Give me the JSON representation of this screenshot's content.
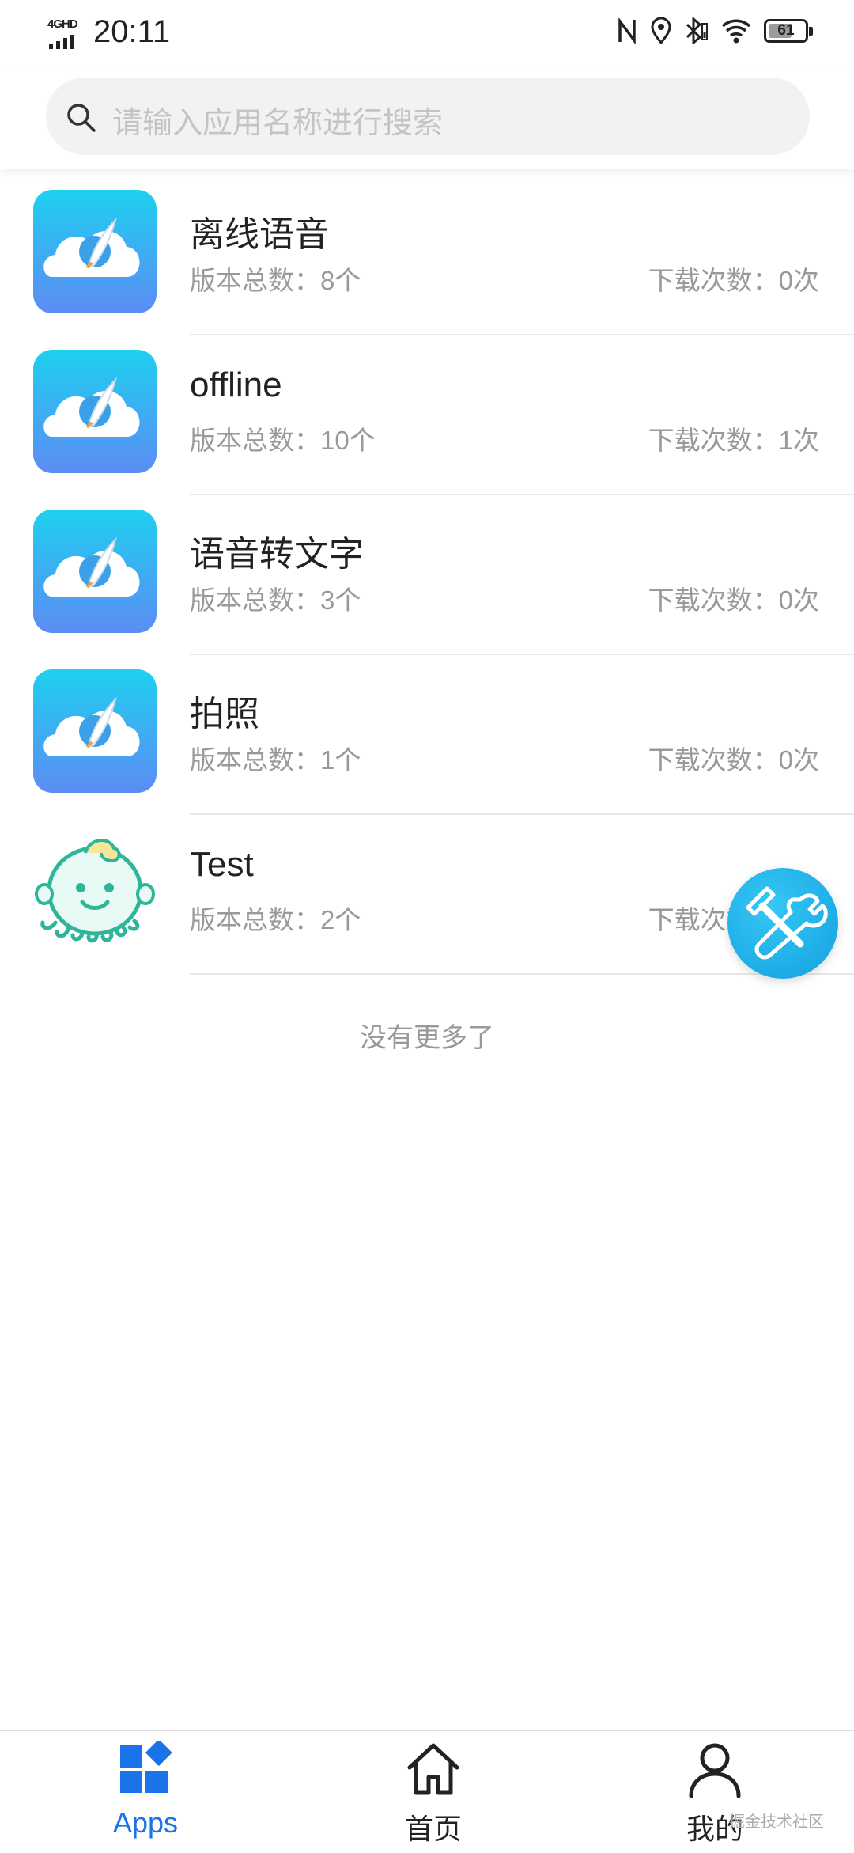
{
  "status_bar": {
    "network": "4GHD",
    "time": "20:11",
    "icons": [
      "nfc-icon",
      "location-icon",
      "bluetooth-icon",
      "wifi-icon"
    ],
    "battery_level": "61"
  },
  "search": {
    "placeholder": "请输入应用名称进行搜索"
  },
  "apps": [
    {
      "name": "离线语音",
      "version_count": "版本总数：8个",
      "download_count": "下载次数：0次",
      "icon": "rocket-cloud-icon"
    },
    {
      "name": "offline",
      "version_count": "版本总数：10个",
      "download_count": "下载次数：1次",
      "icon": "rocket-cloud-icon"
    },
    {
      "name": "语音转文字",
      "version_count": "版本总数：3个",
      "download_count": "下载次数：0次",
      "icon": "rocket-cloud-icon"
    },
    {
      "name": "拍照",
      "version_count": "版本总数：1个",
      "download_count": "下载次数：0次",
      "icon": "rocket-cloud-icon"
    },
    {
      "name": "Test",
      "version_count": "版本总数：2个",
      "download_count": "下载次数：0次",
      "icon": "octopus-icon"
    }
  ],
  "list_end_text": "没有更多了",
  "tabs": [
    {
      "label": "Apps",
      "icon": "apps-grid-icon",
      "active": true
    },
    {
      "label": "首页",
      "icon": "home-icon",
      "active": false
    },
    {
      "label": "我的",
      "icon": "user-icon",
      "active": false
    }
  ],
  "colors": {
    "accent": "#1a73e8",
    "fab": "#1ea6e6",
    "tab_active": "#1a73e8",
    "tab_inactive": "#222222"
  },
  "watermark": "掘金技术社区"
}
